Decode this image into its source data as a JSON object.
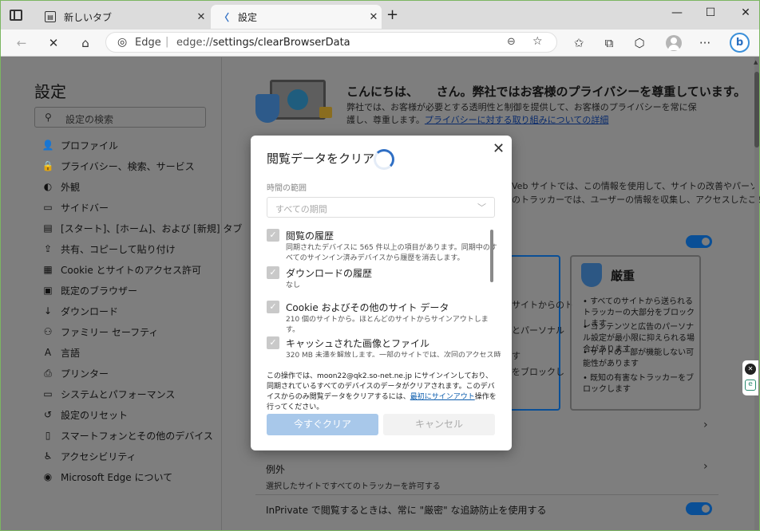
{
  "browser": {
    "tabs": [
      {
        "label": "新しいタブ",
        "active": false
      },
      {
        "label": "設定",
        "active": true
      }
    ],
    "new_tab_symbol": "+",
    "window_controls": {
      "minimize": "—",
      "maximize": "☐",
      "close": "✕"
    },
    "address": {
      "site_label": "Edge",
      "separator": "|",
      "url_prefix": "edge://",
      "url_path": "settings/clearBrowserData"
    },
    "toolbar_icons": [
      "back-icon",
      "stop-icon",
      "home-icon",
      "zoom-icon",
      "favorite-add-icon",
      "favorites-icon",
      "collections-icon",
      "browser-essentials-icon",
      "profile-icon",
      "more-icon",
      "bing-icon"
    ]
  },
  "sidebar": {
    "title": "設定",
    "search_placeholder": "設定の検索",
    "items": [
      {
        "label": "プロファイル",
        "icon": "👤"
      },
      {
        "label": "プライバシー、検索、サービス",
        "icon": "🔒"
      },
      {
        "label": "外観",
        "icon": "◐"
      },
      {
        "label": "サイドバー",
        "icon": "▭"
      },
      {
        "label": "[スタート]、[ホーム]、および [新規] タブ",
        "icon": "▤"
      },
      {
        "label": "共有、コピーして貼り付け",
        "icon": "⇪"
      },
      {
        "label": "Cookie とサイトのアクセス許可",
        "icon": "▦"
      },
      {
        "label": "既定のブラウザー",
        "icon": "▣"
      },
      {
        "label": "ダウンロード",
        "icon": "↓"
      },
      {
        "label": "ファミリー セーフティ",
        "icon": "⚇"
      },
      {
        "label": "言語",
        "icon": "A"
      },
      {
        "label": "プリンター",
        "icon": "⎙"
      },
      {
        "label": "システムとパフォーマンス",
        "icon": "▭"
      },
      {
        "label": "設定のリセット",
        "icon": "↺"
      },
      {
        "label": "スマートフォンとその他のデバイス",
        "icon": "▯"
      },
      {
        "label": "アクセシビリティ",
        "icon": "♿"
      },
      {
        "label": "Microsoft Edge について",
        "icon": "◉"
      }
    ]
  },
  "main": {
    "hero_title": "こんにちは、　　さん。弊社ではお客様のプライバシーを尊重しています。",
    "hero_text": "弊社では、お客様が必要とする透明性と制御を提供して、お客様のプライバシーを常に保護し、尊重します。",
    "hero_link": "プライバシーに対する取り組みについての詳細",
    "partial_line1": "Veb サイトでは、この情報を使用して、サイトの改善やパーソ",
    "partial_line2": "のトラッカーでは、ユーザーの情報を収集し、アクセスしたことが",
    "strict_title": "厳重",
    "strict_bullets": [
      "すべてのサイトから送られるトラッカーの大部分をブロックします",
      "コンテンツと広告のパーソナル設定が最小限に抑えられる場合があります",
      "サイトの一部が機能しない可能性があります",
      "既知の有害なトラッカーをブロックします"
    ],
    "balanced_fragments": [
      "サイトからのト",
      "とパーソナル",
      "す",
      "をブロックし"
    ],
    "exceptions_title": "例外",
    "exceptions_desc": "選択したサイトですべてのトラッカーを許可する",
    "inprivate_label": "InPrivate で閲覧するときは、常に \"厳密\" な追跡防止を使用する"
  },
  "dialog": {
    "title": "閲覧データをクリア",
    "time_range_label": "時間の範囲",
    "time_range_value": "すべての期間",
    "items": [
      {
        "title": "閲覧の履歴",
        "desc": "同期されたデバイスに 565 件以上の項目があります。同期中のすべてのサインイン済みデバイスから履歴を消去します。",
        "checked": true
      },
      {
        "title": "ダウンロードの履歴",
        "desc": "なし",
        "checked": true
      },
      {
        "title": "Cookie およびその他のサイト データ",
        "desc": "210 個のサイトから。ほとんどのサイトからサインアウトします。",
        "checked": true
      },
      {
        "title": "キャッシュされた画像とファイル",
        "desc": "320 MB 未満を解放します。一部のサイトでは、次回のアクセス時",
        "checked": true
      }
    ],
    "note_before_link": "この操作では、moon22@qk2.so-net.ne.jp にサインインしており、同期されているすべてのデバイスのデータがクリアされます。このデバイスからのみ閲覧データをクリアするには、",
    "note_link": "最初にサインアウト",
    "note_after_link": "操作を行ってください。",
    "primary_button": "今すぐクリア",
    "secondary_button": "キャンセル",
    "close_symbol": "✕"
  },
  "colors": {
    "accent": "#0a4f96",
    "primary_button_disabled": "#a8c8ea",
    "frame": "#7bb661"
  }
}
